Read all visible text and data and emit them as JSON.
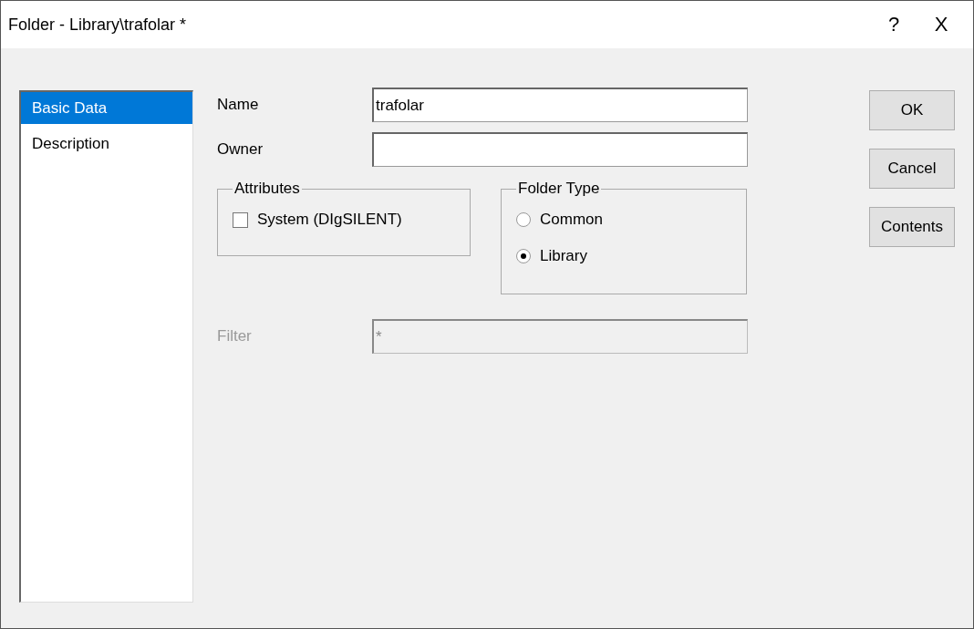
{
  "window": {
    "title": "Folder - Library\\trafolar *",
    "help": "?",
    "close": "X"
  },
  "sidebar": {
    "items": [
      {
        "label": "Basic Data",
        "selected": true
      },
      {
        "label": "Description",
        "selected": false
      }
    ]
  },
  "fields": [
    {
      "label": "Name",
      "value": "trafolar",
      "disabled": false
    },
    {
      "label": "Owner",
      "disabled": false
    }
  ],
  "attributes": {
    "title": "Attributes",
    "options": [
      {
        "label": "System (DIgSILENT)",
        "checked": false
      }
    ]
  },
  "folder_type": {
    "title": "Folder Type",
    "options": [
      {
        "label": "Common",
        "selected": false
      },
      {
        "label": "Library",
        "selected": true
      }
    ]
  },
  "filter": {
    "label": "Filter",
    "value": "*",
    "disabled": true
  },
  "buttons": [
    "OK",
    "Cancel",
    "Contents"
  ]
}
